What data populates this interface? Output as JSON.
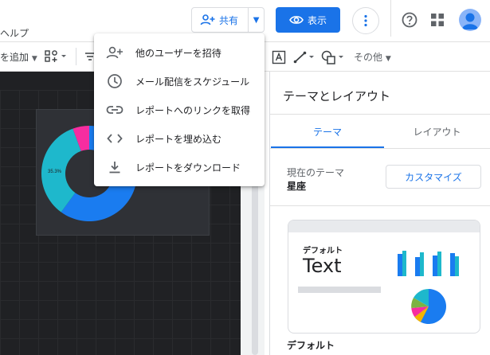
{
  "menubar": {
    "help": "ヘルプ"
  },
  "header": {
    "share_label": "共有",
    "view_label": "表示"
  },
  "toolbar": {
    "add_label": "を追加",
    "other_label": "その他"
  },
  "share_menu": {
    "items": [
      {
        "label": "他のユーザーを招待",
        "icon": "add-person-icon"
      },
      {
        "label": "メール配信をスケジュール",
        "icon": "clock-icon"
      },
      {
        "label": "レポートへのリンクを取得",
        "icon": "link-icon"
      },
      {
        "label": "レポートを埋め込む",
        "icon": "embed-code-icon"
      },
      {
        "label": "レポートをダウンロード",
        "icon": "download-icon"
      }
    ]
  },
  "canvas_chart": {
    "type": "donut",
    "label": "35.3%"
  },
  "theme_panel": {
    "title": "テーマとレイアウト",
    "tabs": [
      {
        "label": "テーマ",
        "active": true
      },
      {
        "label": "レイアウト",
        "active": false
      }
    ],
    "current_theme_label": "現在のテーマ",
    "current_theme_value": "星座",
    "customize_label": "カスタマイズ",
    "theme_card": {
      "small_title": "デフォルト",
      "big_text": "Text",
      "caption": "デフォルト"
    }
  },
  "colors": {
    "accent": "#1a73e8",
    "canvas_bg": "#202124",
    "donut_cyan": "#1eb8cc",
    "donut_blue": "#1a7cf0",
    "donut_pink": "#f72da0"
  }
}
